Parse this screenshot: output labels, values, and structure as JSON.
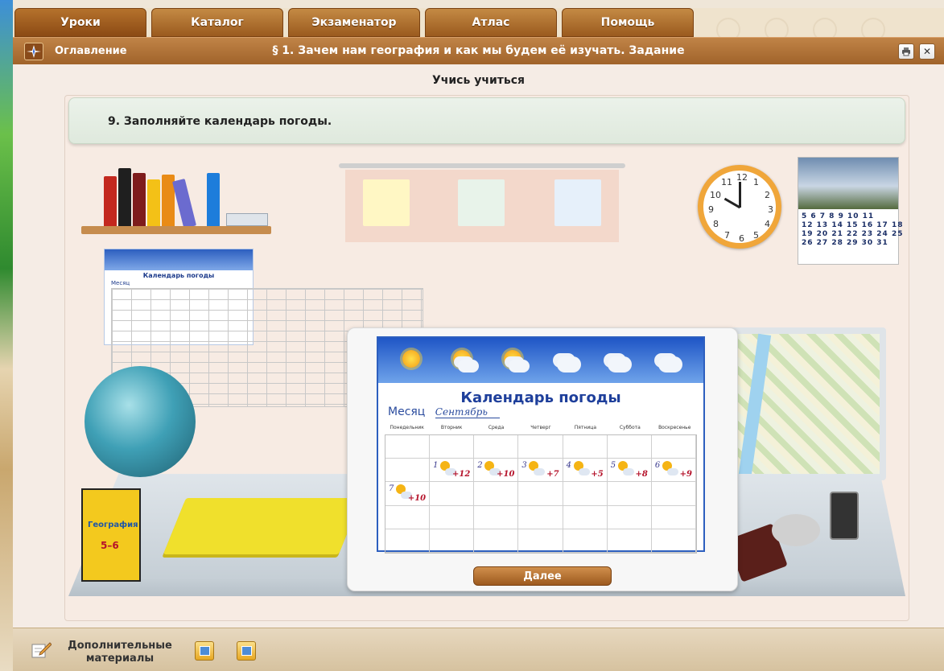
{
  "tabs": [
    {
      "label": "Уроки",
      "active": true
    },
    {
      "label": "Каталог",
      "active": false
    },
    {
      "label": "Экзаменатор",
      "active": false
    },
    {
      "label": "Атлас",
      "active": false
    },
    {
      "label": "Помощь",
      "active": false
    }
  ],
  "titlebar": {
    "toc_label": "Оглавление",
    "title": "§ 1. Зачем нам география и как мы будем её изучать. Задание",
    "print_icon": "printer-icon",
    "close_icon": "close-icon"
  },
  "main": {
    "subtitle": "Учись учиться",
    "task": "9. Заполняйте календарь погоды."
  },
  "wall_calendar": {
    "title": "Календарь погоды",
    "month_label": "Месяц"
  },
  "desk_calendar": {
    "numbers": "5 6 7 8 9 10 11\n12 13 14 15 16 17 18\n19 20 21 22 23 24 25\n26 27 28 29 30 31"
  },
  "clock": {
    "numbers": [
      "12",
      "1",
      "2",
      "3",
      "4",
      "5",
      "6",
      "7",
      "8",
      "9",
      "10",
      "11"
    ]
  },
  "weather_calendar": {
    "title": "Календарь погоды",
    "month_label": "Месяц",
    "month_value": "Сентябрь",
    "days": [
      "Понедельник",
      "Вторник",
      "Среда",
      "Четверг",
      "Пятница",
      "Суббота",
      "Воскресенье"
    ],
    "entries": [
      {
        "row": 1,
        "col": 1,
        "day": "1",
        "temp": "+12",
        "icon": "sun-icon"
      },
      {
        "row": 1,
        "col": 2,
        "day": "2",
        "temp": "+10",
        "icon": "sun-cloud-icon"
      },
      {
        "row": 1,
        "col": 3,
        "day": "3",
        "temp": "+7",
        "icon": "rain-cloud-icon"
      },
      {
        "row": 1,
        "col": 4,
        "day": "4",
        "temp": "+5",
        "icon": "rain-cloud-icon"
      },
      {
        "row": 1,
        "col": 5,
        "day": "5",
        "temp": "+8",
        "icon": "storm-cloud-icon"
      },
      {
        "row": 1,
        "col": 6,
        "day": "6",
        "temp": "+9",
        "icon": "snow-cloud-icon"
      },
      {
        "row": 2,
        "col": 0,
        "day": "7",
        "temp": "+10",
        "icon": "sun-cloud-icon"
      }
    ]
  },
  "next_button": "Далее",
  "dvd": {
    "label": "География",
    "grade": "5–6"
  },
  "bottom": {
    "extra_label": "Дополнительные материалы"
  },
  "colors": {
    "brand_brown": "#a0632a",
    "calendar_blue": "#1f56c6",
    "temp_red": "#b5132b"
  }
}
